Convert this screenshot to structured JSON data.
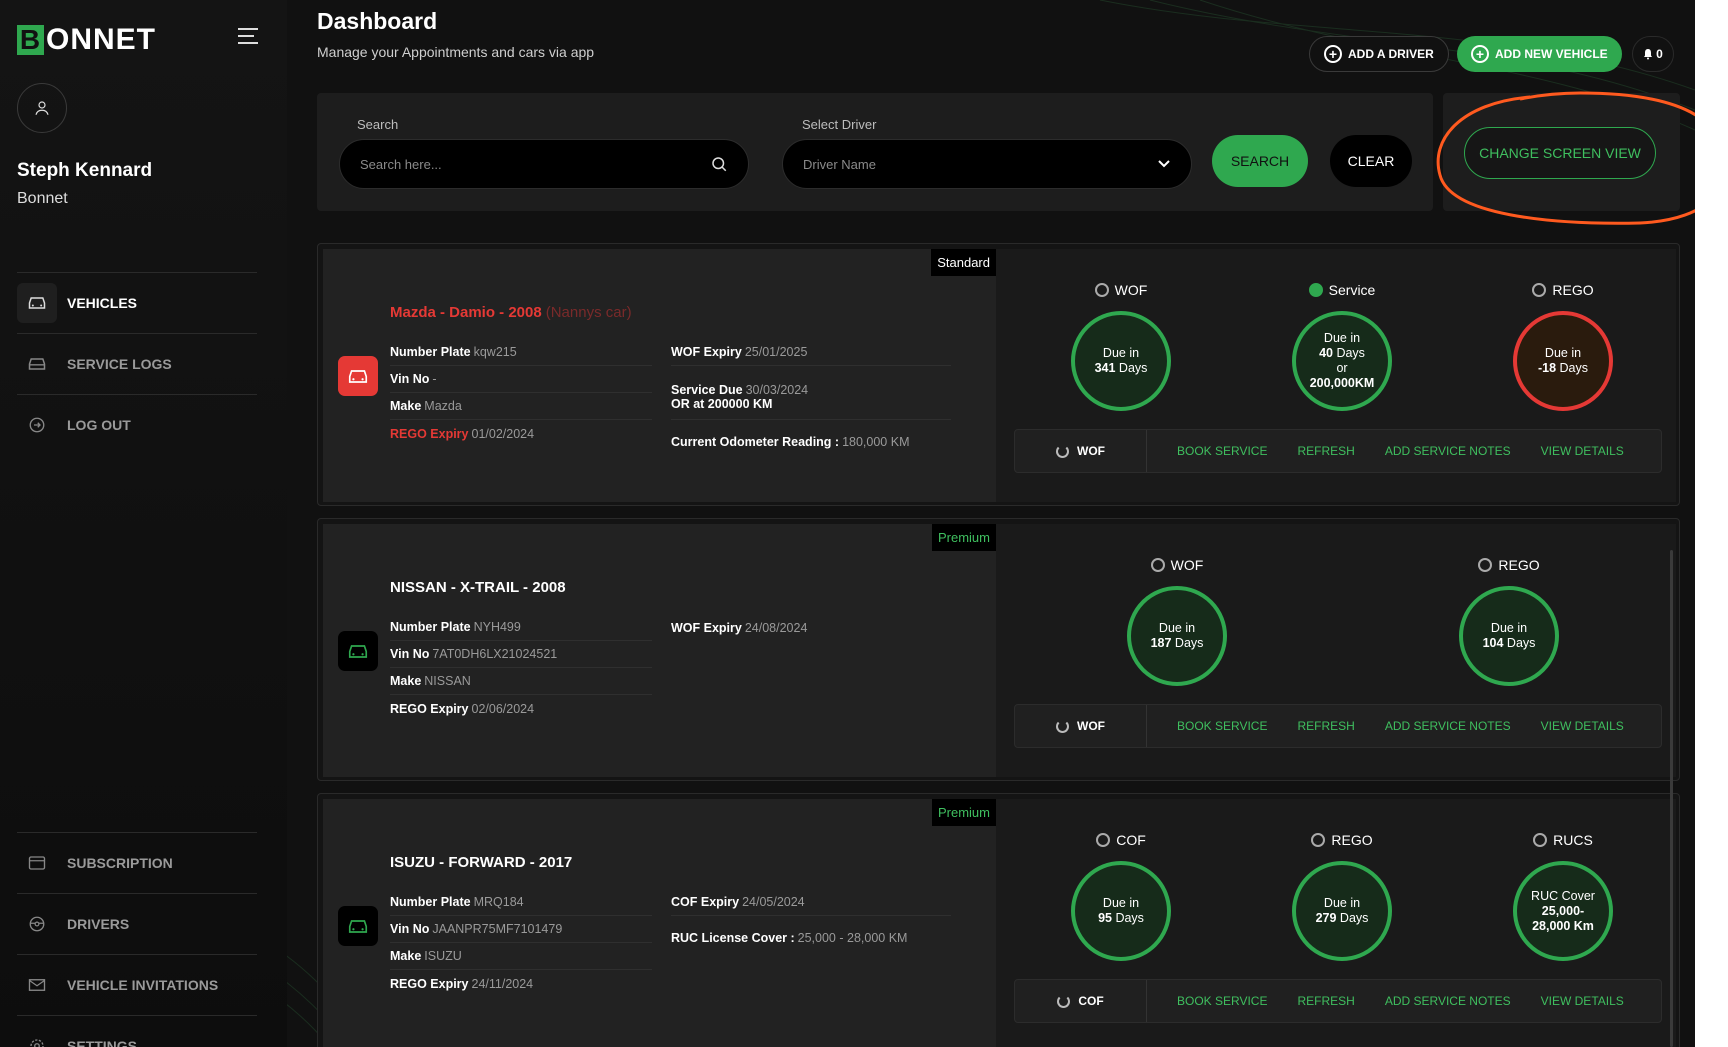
{
  "brand": {
    "logo_initial": "B",
    "logo_rest": "ONNET"
  },
  "user": {
    "name": "Steph Kennard",
    "org": "Bonnet"
  },
  "nav_top": [
    {
      "label": "VEHICLES",
      "icon": "car-icon",
      "active": true
    },
    {
      "label": "SERVICE LOGS",
      "icon": "service-log-icon",
      "active": false
    },
    {
      "label": "LOG OUT",
      "icon": "logout-icon",
      "active": false
    }
  ],
  "nav_bottom": [
    {
      "label": "SUBSCRIPTION",
      "icon": "subscription-icon"
    },
    {
      "label": "DRIVERS",
      "icon": "steering-wheel-icon"
    },
    {
      "label": "VEHICLE INVITATIONS",
      "icon": "mail-icon"
    },
    {
      "label": "SETTINGS",
      "icon": "gear-icon"
    }
  ],
  "header": {
    "title": "Dashboard",
    "subtitle": "Manage your Appointments and cars via app",
    "add_driver": "ADD A DRIVER",
    "add_vehicle": "ADD NEW VEHICLE",
    "notifications": "0"
  },
  "search": {
    "search_label": "Search",
    "search_placeholder": "Search here...",
    "driver_label": "Select Driver",
    "driver_placeholder": "Driver Name",
    "search_button": "SEARCH",
    "clear_button": "CLEAR",
    "change_view_button": "CHANGE SCREEN VIEW"
  },
  "colors": {
    "accent": "#2fa84f",
    "danger": "#e53935",
    "annotation": "#ff5a1f"
  },
  "vehicles": [
    {
      "tier": "Standard",
      "title": "Mazda - Damio - 2008",
      "nickname": "(Nannys car)",
      "alert": true,
      "fields_left": [
        {
          "label": "Number Plate",
          "value": "kqw215"
        },
        {
          "label": "Vin No",
          "value": "-"
        },
        {
          "label": "Make",
          "value": "Mazda"
        },
        {
          "label": "REGO Expiry",
          "value": "01/02/2024",
          "red": true
        }
      ],
      "fields_right": [
        {
          "label": "WOF Expiry",
          "value": "25/01/2025"
        },
        {
          "label": "Service Due",
          "value": "30/03/2024",
          "line2": "OR at 200000 KM"
        },
        {
          "label": "Current Odometer Reading :",
          "value": "180,000 KM"
        }
      ],
      "dues": [
        {
          "name": "WOF",
          "line1": "Due in",
          "bold": "341",
          "line2": "Days"
        },
        {
          "name": "Service",
          "line1": "Due in",
          "bold": "40",
          "line2": "Days",
          "extra1": "or",
          "extra2": "200,000KM",
          "ok": true
        },
        {
          "name": "REGO",
          "line1": "Due in",
          "bold": "-18",
          "line2": "Days",
          "red": true
        }
      ],
      "actions": {
        "first": "WOF",
        "items": [
          "BOOK SERVICE",
          "REFRESH",
          "ADD SERVICE NOTES",
          "VIEW DETAILS"
        ]
      }
    },
    {
      "tier": "Premium",
      "title": "NISSAN - X-TRAIL - 2008",
      "nickname": "",
      "alert": false,
      "fields_left": [
        {
          "label": "Number Plate",
          "value": "NYH499"
        },
        {
          "label": "Vin No",
          "value": "7AT0DH6LX21024521"
        },
        {
          "label": "Make",
          "value": "NISSAN"
        },
        {
          "label": "REGO Expiry",
          "value": "02/06/2024"
        }
      ],
      "fields_right": [
        {
          "label": "WOF Expiry",
          "value": "24/08/2024"
        }
      ],
      "dues": [
        {
          "name": "WOF",
          "line1": "Due in",
          "bold": "187",
          "line2": "Days"
        },
        {
          "name": "REGO",
          "line1": "Due in",
          "bold": "104",
          "line2": "Days"
        }
      ],
      "actions": {
        "first": "WOF",
        "items": [
          "BOOK SERVICE",
          "REFRESH",
          "ADD SERVICE NOTES",
          "VIEW DETAILS"
        ]
      }
    },
    {
      "tier": "Premium",
      "title": "ISUZU - FORWARD - 2017",
      "nickname": "",
      "alert": false,
      "fields_left": [
        {
          "label": "Number Plate",
          "value": "MRQ184"
        },
        {
          "label": "Vin No",
          "value": "JAANPR75MF7101479"
        },
        {
          "label": "Make",
          "value": "ISUZU"
        },
        {
          "label": "REGO Expiry",
          "value": "24/11/2024"
        }
      ],
      "fields_right": [
        {
          "label": "COF Expiry",
          "value": "24/05/2024"
        },
        {
          "label": "RUC License Cover :",
          "value": "25,000 - 28,000 KM"
        }
      ],
      "dues": [
        {
          "name": "COF",
          "line1": "Due in",
          "bold": "95",
          "line2": "Days"
        },
        {
          "name": "REGO",
          "line1": "Due in",
          "bold": "279",
          "line2": "Days"
        },
        {
          "name": "RUCS",
          "line1": "RUC Cover",
          "bold": "25,000-",
          "line2": "28,000 Km",
          "bold2": true
        }
      ],
      "actions": {
        "first": "COF",
        "items": [
          "BOOK SERVICE",
          "REFRESH",
          "ADD SERVICE NOTES",
          "VIEW DETAILS"
        ]
      }
    }
  ]
}
